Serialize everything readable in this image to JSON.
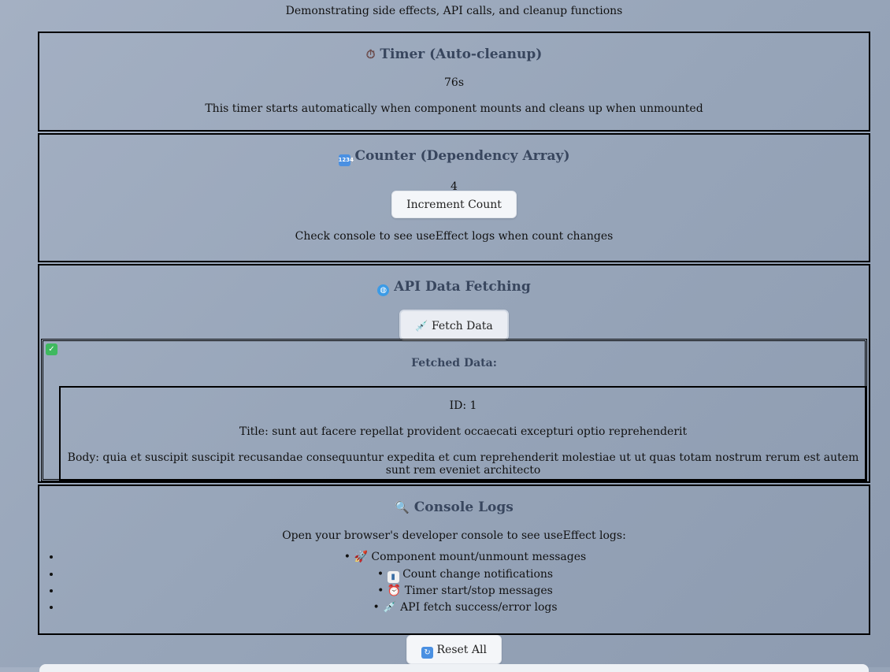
{
  "subtitle": "Demonstrating side effects, API calls, and cleanup functions",
  "timer": {
    "icon": "stopwatch-icon",
    "title": "Timer (Auto-cleanup)",
    "value": "76s",
    "description": "This timer starts automatically when component mounts and cleans up when unmounted"
  },
  "counter": {
    "icon": "numbers-icon",
    "title": "Counter (Dependency Array)",
    "value": "4",
    "button_label": "Increment Count",
    "description": "Check console to see useEffect logs when count changes"
  },
  "api": {
    "icon": "globe-icon",
    "title": "API Data Fetching",
    "button_icon": "syringe-icon",
    "button_label": "Fetch Data",
    "result_icon": "check-icon",
    "fetched_title": "Fetched Data:",
    "id_line": "ID: 1",
    "title_line": "Title: sunt aut facere repellat provident occaecati excepturi optio reprehenderit",
    "body_line": "Body: quia et suscipit suscipit recusandae consequuntur expedita et cum reprehenderit molestiae ut ut quas totam nostrum rerum est autem sunt rem eveniet architecto"
  },
  "console": {
    "icon": "magnifier-icon",
    "title": "Console Logs",
    "intro": "Open your browser's developer console to see useEffect logs:",
    "items": [
      {
        "icon": "rocket-icon",
        "text": "Component mount/unmount messages"
      },
      {
        "icon": "chart-icon",
        "text": "Count change notifications"
      },
      {
        "icon": "alarm-clock-icon",
        "text": "Timer start/stop messages"
      },
      {
        "icon": "syringe-icon",
        "text": "API fetch success/error logs"
      }
    ]
  },
  "reset": {
    "icon": "refresh-icon",
    "label": "Reset All"
  },
  "colors": {
    "heading": "#38465e",
    "panel_border": "#000000",
    "check_green": "#3fb95f",
    "badge_blue": "#4a90e2"
  }
}
